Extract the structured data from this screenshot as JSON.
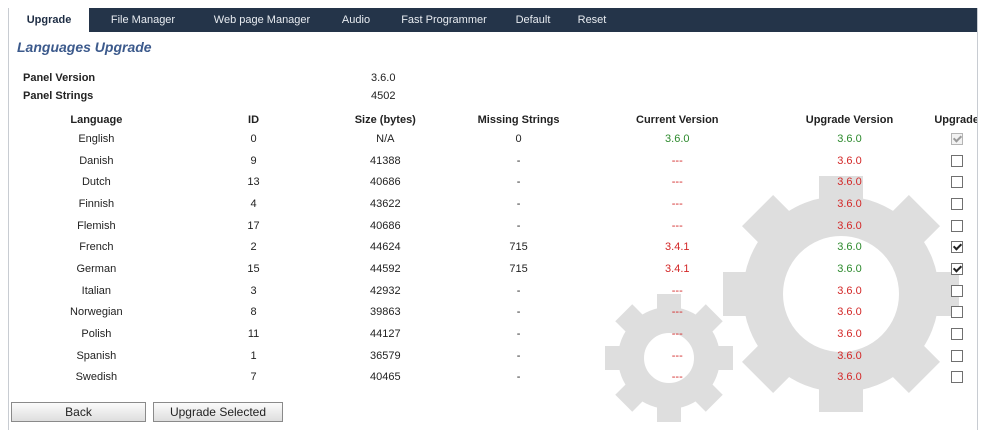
{
  "tabs": [
    {
      "label": "Upgrade",
      "active": true
    },
    {
      "label": "File Manager",
      "active": false
    },
    {
      "label": "Web page Manager",
      "active": false
    },
    {
      "label": "Audio",
      "active": false
    },
    {
      "label": "Fast Programmer",
      "active": false
    },
    {
      "label": "Default",
      "active": false
    },
    {
      "label": "Reset",
      "active": false
    }
  ],
  "page_title": "Languages Upgrade",
  "panel": {
    "version_label": "Panel Version",
    "version_value": "3.6.0",
    "strings_label": "Panel Strings",
    "strings_value": "4502"
  },
  "table": {
    "headers": [
      "Language",
      "ID",
      "Size (bytes)",
      "Missing Strings",
      "Current Version",
      "Upgrade Version",
      "Upgrade"
    ],
    "rows": [
      {
        "language": "English",
        "id": "0",
        "size": "N/A",
        "missing": "0",
        "current": "3.6.0",
        "current_status": "ok",
        "upgrade_version": "3.6.0",
        "upgrade_status": "ok",
        "checked": true,
        "disabled": true
      },
      {
        "language": "Danish",
        "id": "9",
        "size": "41388",
        "missing": "-",
        "current": "---",
        "current_status": "missing",
        "upgrade_version": "3.6.0",
        "upgrade_status": "new",
        "checked": false,
        "disabled": false
      },
      {
        "language": "Dutch",
        "id": "13",
        "size": "40686",
        "missing": "-",
        "current": "---",
        "current_status": "missing",
        "upgrade_version": "3.6.0",
        "upgrade_status": "new",
        "checked": false,
        "disabled": false
      },
      {
        "language": "Finnish",
        "id": "4",
        "size": "43622",
        "missing": "-",
        "current": "---",
        "current_status": "missing",
        "upgrade_version": "3.6.0",
        "upgrade_status": "new",
        "checked": false,
        "disabled": false
      },
      {
        "language": "Flemish",
        "id": "17",
        "size": "40686",
        "missing": "-",
        "current": "---",
        "current_status": "missing",
        "upgrade_version": "3.6.0",
        "upgrade_status": "new",
        "checked": false,
        "disabled": false
      },
      {
        "language": "French",
        "id": "2",
        "size": "44624",
        "missing": "715",
        "current": "3.4.1",
        "current_status": "outdated",
        "upgrade_version": "3.6.0",
        "upgrade_status": "ok",
        "checked": true,
        "disabled": false
      },
      {
        "language": "German",
        "id": "15",
        "size": "44592",
        "missing": "715",
        "current": "3.4.1",
        "current_status": "outdated",
        "upgrade_version": "3.6.0",
        "upgrade_status": "ok",
        "checked": true,
        "disabled": false
      },
      {
        "language": "Italian",
        "id": "3",
        "size": "42932",
        "missing": "-",
        "current": "---",
        "current_status": "missing",
        "upgrade_version": "3.6.0",
        "upgrade_status": "new",
        "checked": false,
        "disabled": false
      },
      {
        "language": "Norwegian",
        "id": "8",
        "size": "39863",
        "missing": "-",
        "current": "---",
        "current_status": "missing",
        "upgrade_version": "3.6.0",
        "upgrade_status": "new",
        "checked": false,
        "disabled": false
      },
      {
        "language": "Polish",
        "id": "11",
        "size": "44127",
        "missing": "-",
        "current": "---",
        "current_status": "missing",
        "upgrade_version": "3.6.0",
        "upgrade_status": "new",
        "checked": false,
        "disabled": false
      },
      {
        "language": "Spanish",
        "id": "1",
        "size": "36579",
        "missing": "-",
        "current": "---",
        "current_status": "missing",
        "upgrade_version": "3.6.0",
        "upgrade_status": "new",
        "checked": false,
        "disabled": false
      },
      {
        "language": "Swedish",
        "id": "7",
        "size": "40465",
        "missing": "-",
        "current": "---",
        "current_status": "missing",
        "upgrade_version": "3.6.0",
        "upgrade_status": "new",
        "checked": false,
        "disabled": false
      }
    ]
  },
  "buttons": {
    "back": "Back",
    "upgrade_selected": "Upgrade Selected"
  },
  "colors": {
    "tabbar": "#243449",
    "title": "#3c5a8c",
    "ok": "#2d8a2d",
    "warn": "#d32727"
  },
  "background_icon": "gears-watermark-icon"
}
